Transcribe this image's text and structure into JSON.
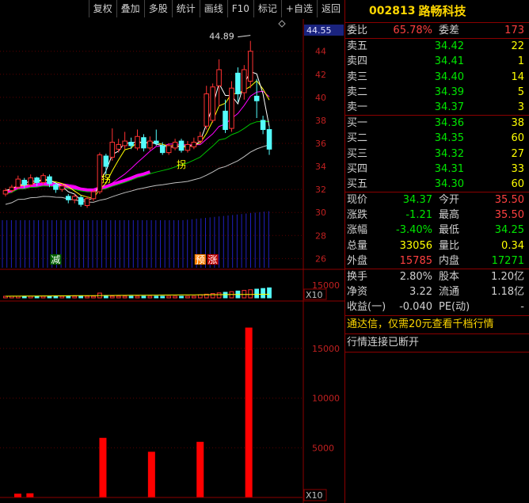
{
  "toolbar": {
    "buttons": [
      "复权",
      "叠加",
      "多股",
      "统计",
      "画线",
      "F10",
      "标记",
      "+自选",
      "返回"
    ]
  },
  "stock": {
    "code": "002813",
    "name": "路畅科技"
  },
  "order_book": {
    "wei_bi_label": "委比",
    "wei_bi": "65.78%",
    "wei_cha_label": "委差",
    "wei_cha": "173",
    "asks": [
      {
        "label": "卖五",
        "price": "34.42",
        "vol": "22"
      },
      {
        "label": "卖四",
        "price": "34.41",
        "vol": "1"
      },
      {
        "label": "卖三",
        "price": "34.40",
        "vol": "14"
      },
      {
        "label": "卖二",
        "price": "34.39",
        "vol": "5"
      },
      {
        "label": "卖一",
        "price": "34.37",
        "vol": "3"
      }
    ],
    "bids": [
      {
        "label": "买一",
        "price": "34.36",
        "vol": "38"
      },
      {
        "label": "买二",
        "price": "34.35",
        "vol": "60"
      },
      {
        "label": "买三",
        "price": "34.32",
        "vol": "27"
      },
      {
        "label": "买四",
        "price": "34.31",
        "vol": "33"
      },
      {
        "label": "买五",
        "price": "34.30",
        "vol": "60"
      }
    ]
  },
  "quote": {
    "rows": [
      {
        "l1": "现价",
        "v1": "34.37",
        "l2": "今开",
        "v2": "35.50"
      },
      {
        "l1": "涨跌",
        "v1": "-1.21",
        "l2": "最高",
        "v2": "35.50"
      },
      {
        "l1": "涨幅",
        "v1": "-3.40%",
        "l2": "最低",
        "v2": "34.25"
      },
      {
        "l1": "总量",
        "v1": "33056",
        "l2": "量比",
        "v2": "0.34"
      },
      {
        "l1": "外盘",
        "v1": "15785",
        "l2": "内盘",
        "v2": "17271"
      }
    ]
  },
  "fundamentals": {
    "rows": [
      {
        "l1": "换手",
        "v1": "2.80%",
        "l2": "股本",
        "v2": "1.20亿"
      },
      {
        "l1": "净资",
        "v1": "3.22",
        "l2": "流通",
        "v2": "1.18亿"
      },
      {
        "l1": "收益(一)",
        "v1": "-0.040",
        "l2": "PE(动)",
        "v2": "-"
      }
    ]
  },
  "messages": {
    "promo": "通达信，仅需20元查看千档行情",
    "status": "行情连接已断开"
  },
  "chart_data": {
    "type": "candlestick",
    "price_axis": {
      "ticks": [
        44.0,
        42.0,
        40.0,
        38.0,
        36.0,
        34.0,
        32.0,
        30.0,
        28.0,
        26.0
      ],
      "current": "44.55",
      "ylim": [
        25.2,
        46.8
      ]
    },
    "high_marker": "44.89",
    "signals": [
      {
        "text": "减",
        "index": 8
      },
      {
        "text": "拐",
        "index": 16
      },
      {
        "text": "拐",
        "index": 28
      },
      {
        "text": "预",
        "index": 31
      },
      {
        "text": "涨",
        "index": 33
      }
    ],
    "candles": [
      {
        "o": 31.6,
        "c": 31.9,
        "h": 32.1,
        "l": 31.4
      },
      {
        "o": 31.9,
        "c": 32.2,
        "h": 32.4,
        "l": 31.7
      },
      {
        "o": 32.2,
        "c": 32.9,
        "h": 33.2,
        "l": 32.0
      },
      {
        "o": 32.8,
        "c": 32.4,
        "h": 33.0,
        "l": 32.1
      },
      {
        "o": 32.4,
        "c": 33.0,
        "h": 33.3,
        "l": 32.2
      },
      {
        "o": 33.0,
        "c": 32.6,
        "h": 33.1,
        "l": 32.3
      },
      {
        "o": 32.6,
        "c": 33.2,
        "h": 33.4,
        "l": 32.4
      },
      {
        "o": 33.1,
        "c": 32.5,
        "h": 33.3,
        "l": 32.2
      },
      {
        "o": 32.4,
        "c": 32.0,
        "h": 32.6,
        "l": 31.7
      },
      {
        "o": 32.0,
        "c": 32.3,
        "h": 32.5,
        "l": 31.8
      },
      {
        "o": 31.4,
        "c": 31.1,
        "h": 31.6,
        "l": 30.8
      },
      {
        "o": 31.1,
        "c": 31.4,
        "h": 31.6,
        "l": 30.8
      },
      {
        "o": 31.3,
        "c": 30.7,
        "h": 31.5,
        "l": 30.5
      },
      {
        "o": 30.6,
        "c": 31.2,
        "h": 31.4,
        "l": 30.4
      },
      {
        "o": 31.2,
        "c": 31.8,
        "h": 32.0,
        "l": 31.0
      },
      {
        "o": 31.8,
        "c": 35.0,
        "h": 35.2,
        "l": 31.6
      },
      {
        "o": 34.9,
        "c": 34.0,
        "h": 35.1,
        "l": 33.2
      },
      {
        "o": 34.8,
        "c": 36.1,
        "h": 37.3,
        "l": 34.5
      },
      {
        "o": 35.5,
        "c": 35.9,
        "h": 36.4,
        "l": 35.2
      },
      {
        "o": 35.8,
        "c": 36.2,
        "h": 37.0,
        "l": 35.5
      },
      {
        "o": 36.1,
        "c": 35.8,
        "h": 36.5,
        "l": 35.5
      },
      {
        "o": 35.6,
        "c": 36.6,
        "h": 37.2,
        "l": 35.4
      },
      {
        "o": 36.5,
        "c": 35.6,
        "h": 36.8,
        "l": 35.3
      },
      {
        "o": 35.6,
        "c": 36.2,
        "h": 36.6,
        "l": 35.4
      },
      {
        "o": 36.2,
        "c": 36.0,
        "h": 37.2,
        "l": 35.8
      },
      {
        "o": 35.8,
        "c": 35.2,
        "h": 36.1,
        "l": 35.0
      },
      {
        "o": 35.2,
        "c": 35.8,
        "h": 36.0,
        "l": 35.0
      },
      {
        "o": 35.6,
        "c": 36.1,
        "h": 36.4,
        "l": 35.4
      },
      {
        "o": 36.2,
        "c": 35.4,
        "h": 36.4,
        "l": 35.2
      },
      {
        "o": 35.4,
        "c": 35.9,
        "h": 36.2,
        "l": 35.2
      },
      {
        "o": 35.7,
        "c": 36.1,
        "h": 36.5,
        "l": 35.5
      },
      {
        "o": 36.2,
        "c": 36.6,
        "h": 37.0,
        "l": 36.0
      },
      {
        "o": 37.5,
        "c": 40.3,
        "h": 41.0,
        "l": 37.2
      },
      {
        "o": 38.0,
        "c": 40.9,
        "h": 41.2,
        "l": 37.8
      },
      {
        "o": 41.0,
        "c": 42.4,
        "h": 43.3,
        "l": 39.2
      },
      {
        "o": 38.8,
        "c": 37.2,
        "h": 39.8,
        "l": 36.9
      },
      {
        "o": 37.3,
        "c": 40.8,
        "h": 41.4,
        "l": 37.0
      },
      {
        "o": 42.1,
        "c": 40.3,
        "h": 42.6,
        "l": 39.6
      },
      {
        "o": 40.4,
        "c": 42.4,
        "h": 42.8,
        "l": 39.8
      },
      {
        "o": 41.4,
        "c": 44.0,
        "h": 44.9,
        "l": 40.8
      },
      {
        "o": 40.1,
        "c": 39.7,
        "h": 41.6,
        "l": 38.2
      },
      {
        "o": 38.0,
        "c": 37.2,
        "h": 38.4,
        "l": 36.8
      },
      {
        "o": 37.2,
        "c": 35.5,
        "h": 37.5,
        "l": 35.0
      }
    ],
    "volume_bars": [
      380,
      420,
      0,
      0,
      0,
      0,
      0,
      6000,
      0,
      0,
      0,
      4600,
      0,
      0,
      0,
      5600,
      0,
      0,
      0,
      17100
    ],
    "volume_axis": {
      "ticks": [
        15000,
        10000,
        5000
      ],
      "label": "X10",
      "ylim": [
        0,
        18500
      ]
    },
    "sub_axis": {
      "ticks": [
        15000
      ],
      "label": "X10"
    }
  }
}
